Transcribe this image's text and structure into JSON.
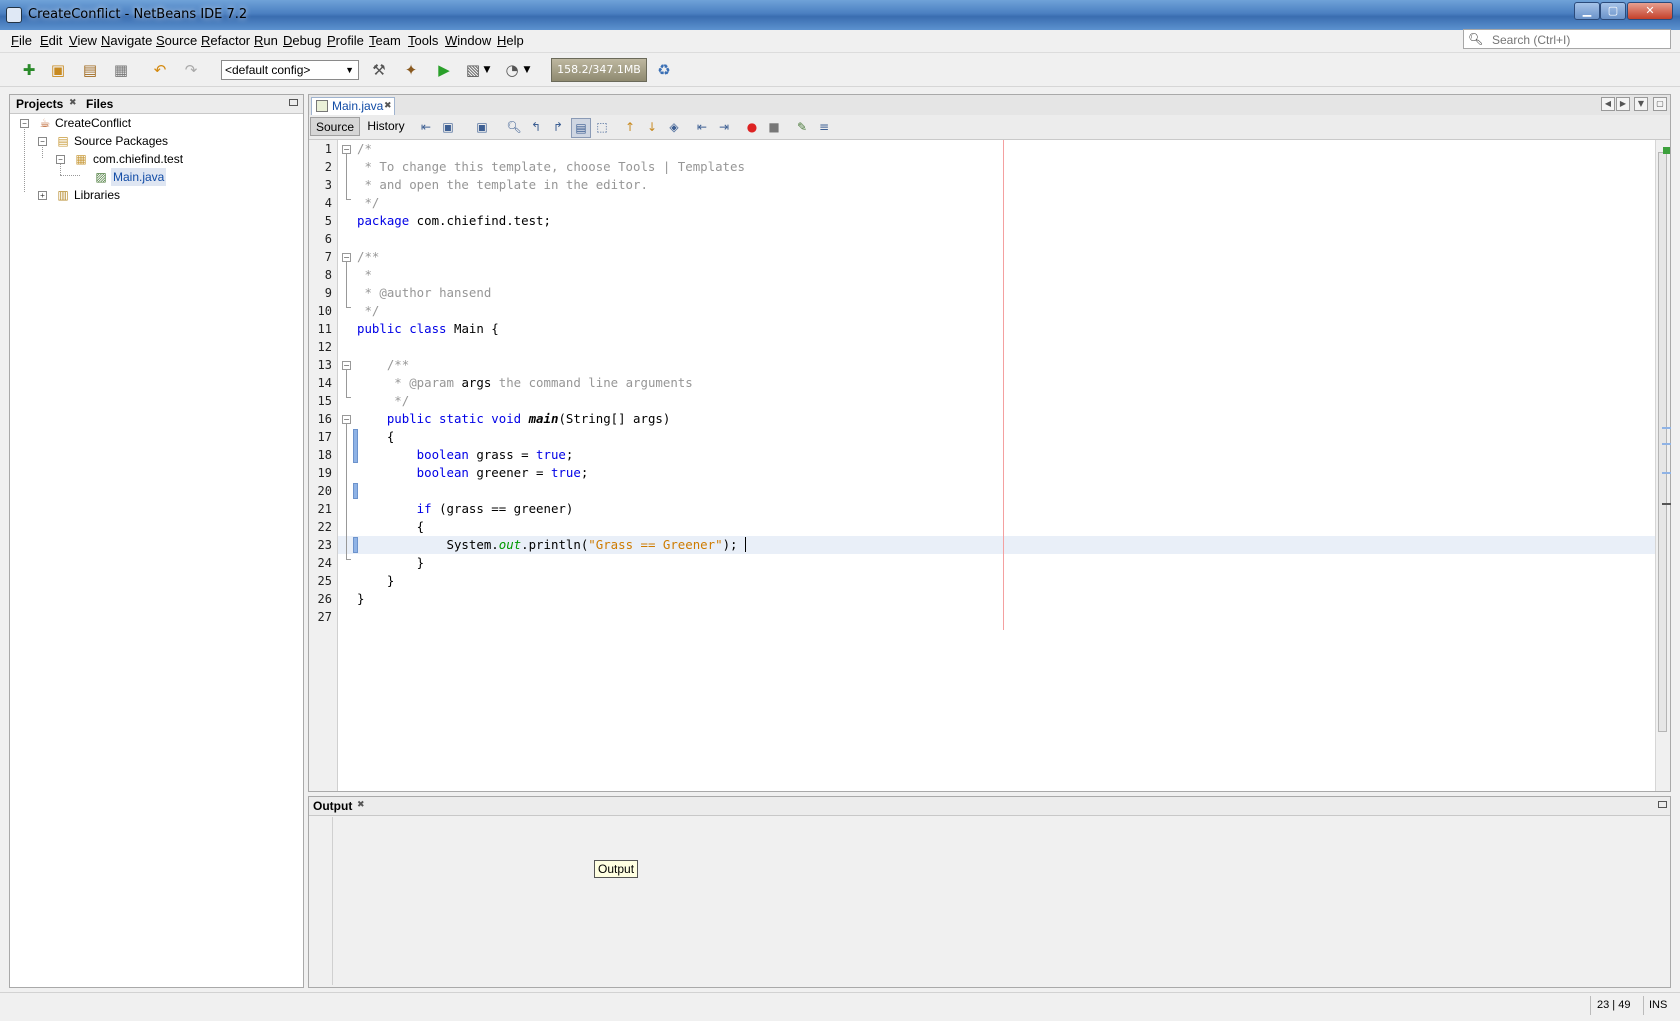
{
  "window": {
    "title": "CreateConflict - NetBeans IDE 7.2",
    "close_glyph": "✕",
    "min_glyph": "▁",
    "max_glyph": "▢"
  },
  "menu": [
    "File",
    "Edit",
    "View",
    "Navigate",
    "Source",
    "Refactor",
    "Run",
    "Debug",
    "Profile",
    "Team",
    "Tools",
    "Window",
    "Help"
  ],
  "search": {
    "placeholder": "Search (Ctrl+I)"
  },
  "toolbar": {
    "config": "<default config>",
    "memory": "158.2/347.1MB"
  },
  "projects": {
    "tabs": [
      "Projects",
      "Files"
    ],
    "tree": [
      {
        "label": "CreateConflict",
        "icon": "coffee-cup-icon"
      },
      {
        "label": "Source Packages",
        "icon": "source-packages-icon"
      },
      {
        "label": "com.chiefind.test",
        "icon": "package-icon"
      },
      {
        "label": "Main.java",
        "icon": "java-file-icon"
      },
      {
        "label": "Libraries",
        "icon": "libraries-icon"
      }
    ]
  },
  "editor": {
    "tab": "Main.java",
    "modes": [
      "Source",
      "History"
    ],
    "line_numbers": [
      "1",
      "2",
      "3",
      "4",
      "5",
      "6",
      "7",
      "8",
      "9",
      "10",
      "11",
      "12",
      "13",
      "14",
      "15",
      "16",
      "17",
      "18",
      "19",
      "20",
      "21",
      "22",
      "23",
      "24",
      "25",
      "26",
      "27"
    ],
    "code": {
      "l1": "/*",
      "l2": " * To change this template, choose Tools | Templates",
      "l3": " * and open the template in the editor.",
      "l4": " */",
      "l5_kw": "package",
      "l5_rest": " com.chiefind.test;",
      "l7": "/**",
      "l8": " *",
      "l9_a": " * @author",
      "l9_b": " hansend",
      "l10": " */",
      "l11_kw": "public class",
      "l11_rest": " Main {",
      "l13": "    /**",
      "l14_a": "     * @param",
      "l14_b": " args",
      "l14_c": " the command line arguments",
      "l15": "     */",
      "l16_kw": "    public static void",
      "l16_m": " main",
      "l16_rest": "(String[] args)",
      "l17": "    {",
      "l18_kw": "        boolean",
      "l18_a": " grass = ",
      "l18_v": "true",
      "l18_e": ";",
      "l19_kw": "        boolean",
      "l19_a": " greener = ",
      "l19_v": "true",
      "l19_e": ";",
      "l21_kw": "        if",
      "l21_rest": " (grass == greener)",
      "l22": "        {",
      "l23_a": "            System.",
      "l23_f": "out",
      "l23_b": ".println(",
      "l23_s": "\"Grass == Greener\"",
      "l23_e": ");",
      "l24": "        }",
      "l25": "    }",
      "l26": "}"
    }
  },
  "output": {
    "tab": "Output",
    "tooltip": "Output"
  },
  "status": {
    "position": "23 | 49",
    "mode": "INS"
  }
}
